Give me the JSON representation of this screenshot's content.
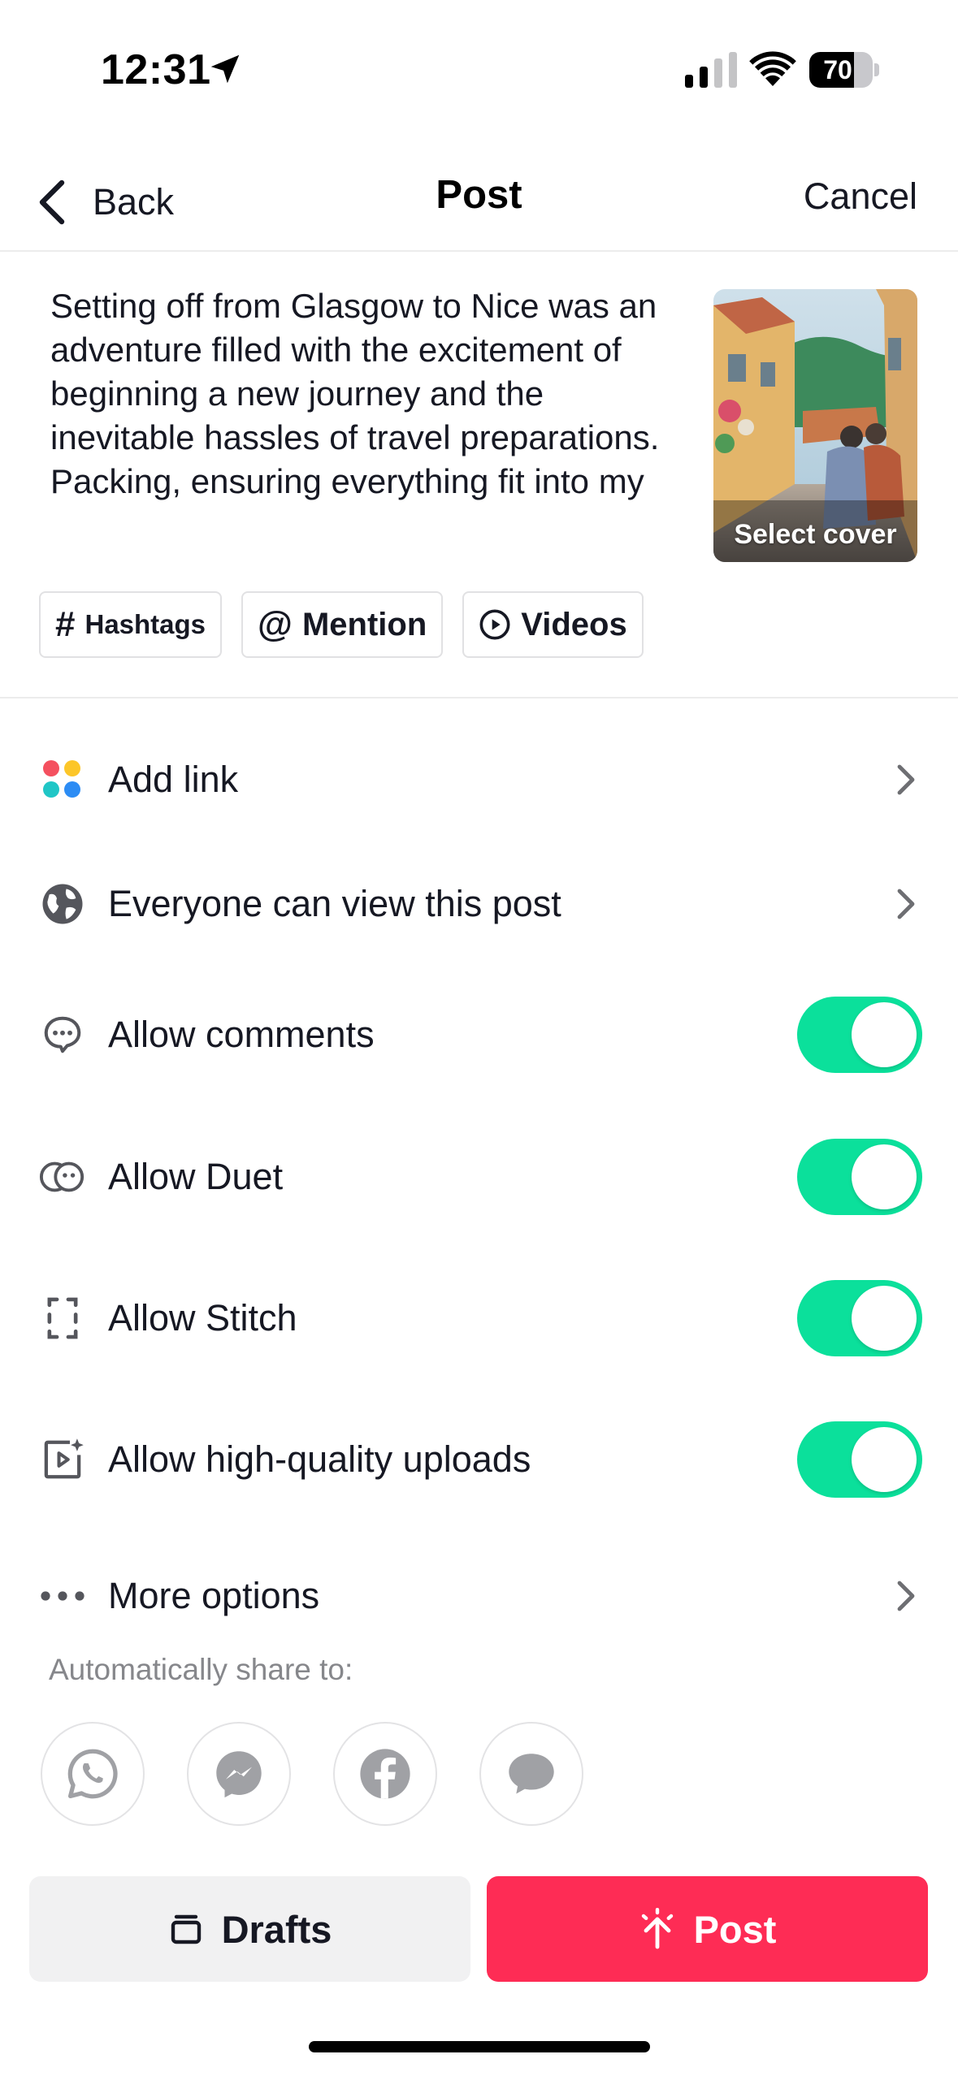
{
  "status_bar": {
    "time": "12:31",
    "battery_percent": "70",
    "battery_level": 0.7
  },
  "nav": {
    "back_label": "Back",
    "title": "Post",
    "cancel_label": "Cancel"
  },
  "caption": {
    "text": "Setting off from Glasgow to Nice was an adventure filled with the excitement of beginning a new journey and the inevitable hassles of travel preparations. Packing, ensuring everything fit into my"
  },
  "cover": {
    "label": "Select cover"
  },
  "chips": [
    {
      "icon": "#",
      "label": "Hashtags"
    },
    {
      "icon": "@",
      "label": "Mention"
    },
    {
      "icon": "play-circle-icon",
      "label": "Videos"
    }
  ],
  "settings": {
    "add_link": "Add link",
    "visibility": "Everyone can view this post",
    "allow_comments": "Allow comments",
    "allow_duet": "Allow Duet",
    "allow_stitch": "Allow Stitch",
    "allow_hq": "Allow high-quality uploads",
    "more_options": "More options"
  },
  "toggles": {
    "allow_comments": true,
    "allow_duet": true,
    "allow_stitch": true,
    "allow_hq": true
  },
  "share": {
    "label": "Automatically share to:",
    "targets": [
      "whatsapp-icon",
      "messenger-icon",
      "facebook-icon",
      "sms-icon"
    ]
  },
  "footer": {
    "drafts_label": "Drafts",
    "post_label": "Post"
  },
  "colors": {
    "accent_post": "#fe2c55",
    "toggle_on": "#0be09b",
    "drafts_bg": "#f1f1f2"
  }
}
